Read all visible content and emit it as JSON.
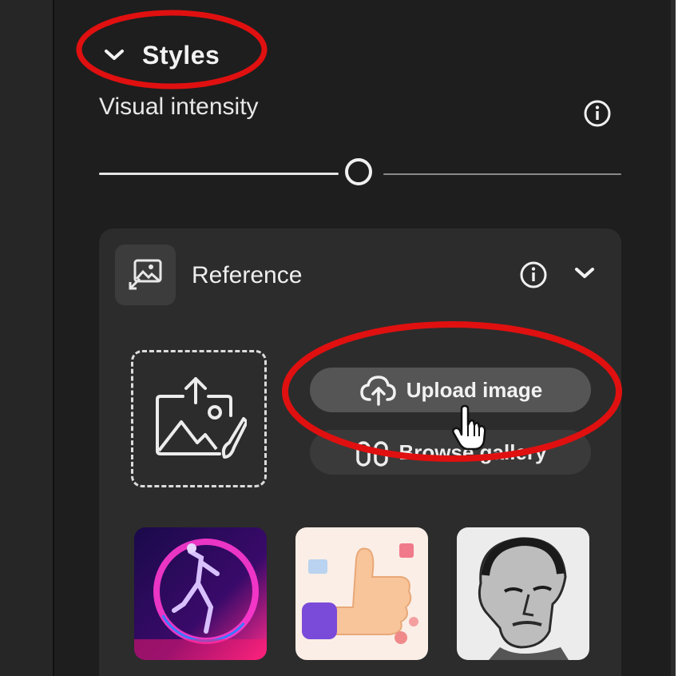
{
  "styles_section": {
    "title": "Styles",
    "expanded": true,
    "chevron_icon": "chevron-down-icon"
  },
  "visual_intensity": {
    "label": "Visual intensity",
    "info_icon": "info-icon",
    "level": 0.5
  },
  "reference": {
    "label": "Reference",
    "icon": "image-reference-icon",
    "info_icon": "info-icon",
    "chevron_icon": "chevron-down-icon",
    "dropzone_icon": "image-upload-icon",
    "upload_button": {
      "label": "Upload image",
      "icon": "cloud-upload-icon"
    },
    "browse_button": {
      "label": "Browse gallery",
      "icon": "binoculars-icon"
    },
    "gallery": [
      {
        "name": "neon-dancer-thumbnail"
      },
      {
        "name": "3d-thumbs-up-thumbnail"
      },
      {
        "name": "engraved-portrait-thumbnail"
      }
    ]
  },
  "annotations": {
    "highlight_color": "#e01010"
  },
  "colors": {
    "panel_bg": "#1e1e1e",
    "card_bg": "#2c2c2c",
    "upload_btn_bg": "#555555",
    "text": "#f2f2f2"
  }
}
